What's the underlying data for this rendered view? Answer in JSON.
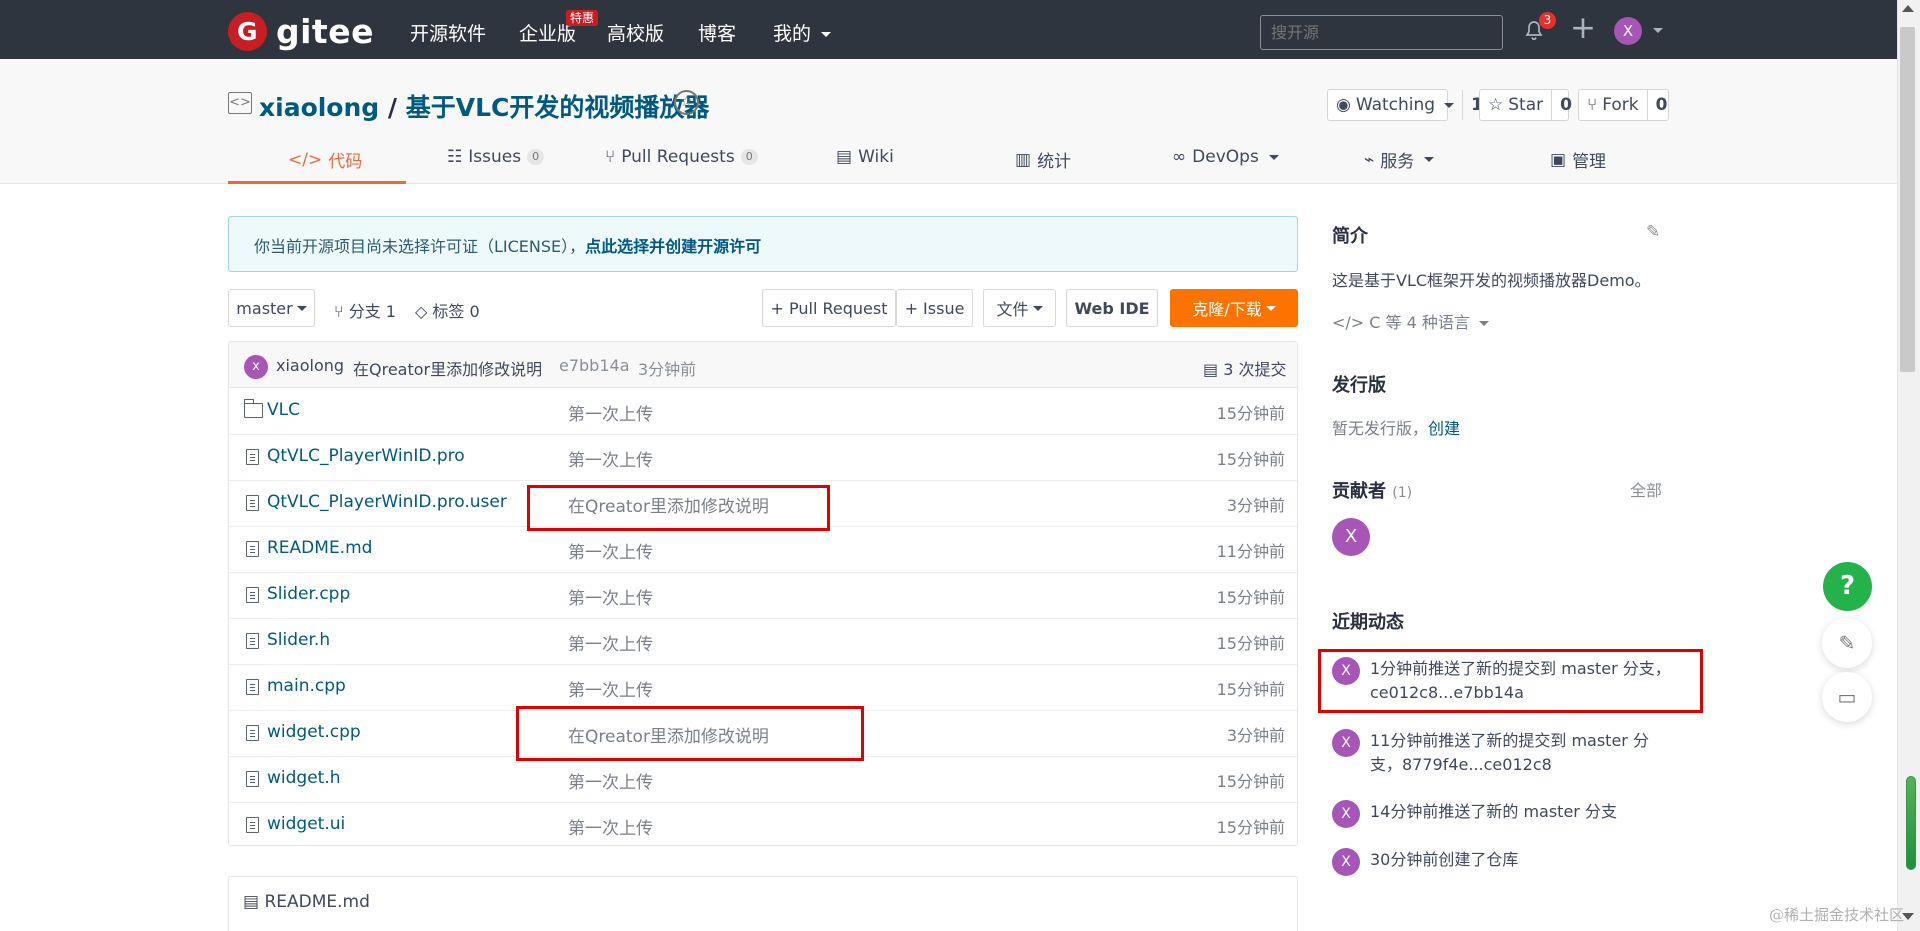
{
  "top_nav": {
    "brand": "gitee",
    "logo_letter": "G",
    "items": [
      "开源软件",
      "企业版",
      "高校版",
      "博客",
      "我的"
    ],
    "hot_badge": "特惠",
    "search_placeholder": "搜开源",
    "notification_count": "3",
    "plus_icon": "+",
    "user_avatar": "X"
  },
  "repo": {
    "owner": "xiaolong",
    "separator": "/",
    "name": "基于VLC开发的视频播放器",
    "repo_icon": "<>",
    "medal_icon": "☆",
    "watch": {
      "label": "Watching",
      "count": "1"
    },
    "star": {
      "label": "Star",
      "count": "0"
    },
    "fork": {
      "label": "Fork",
      "count": "0"
    }
  },
  "tabs": [
    {
      "label": "代码",
      "icon": "</>"
    },
    {
      "label": "Issues",
      "count": "0",
      "icon": "☷"
    },
    {
      "label": "Pull Requests",
      "count": "0",
      "icon": "⑂"
    },
    {
      "label": "Wiki",
      "icon": "▤"
    },
    {
      "label": "统计",
      "icon": "▥"
    },
    {
      "label": "DevOps",
      "icon": "∞"
    },
    {
      "label": "服务",
      "icon": "⌁"
    },
    {
      "label": "管理",
      "icon": "▣"
    }
  ],
  "license": {
    "text": "你当前开源项目尚未选择许可证（LICENSE），",
    "link": "点此选择并创建开源许可"
  },
  "toolbar": {
    "branch": "master",
    "branch_count": "分支 1",
    "tag_count": "标签 0",
    "pull_request": "+ Pull Request",
    "issue": "+ Issue",
    "files": "文件",
    "web_ide": "Web IDE",
    "clone": "克隆/下载"
  },
  "last_commit": {
    "author": "xiaolong",
    "avatar": "x",
    "message": "在Qreator里添加修改说明",
    "hash": "e7bb14a",
    "time": "3分钟前",
    "commits": "3 次提交"
  },
  "files": [
    {
      "name": "VLC",
      "type": "folder",
      "message": "第一次上传",
      "time": "15分钟前"
    },
    {
      "name": "QtVLC_PlayerWinID.pro",
      "type": "file",
      "message": "第一次上传",
      "time": "15分钟前"
    },
    {
      "name": "QtVLC_PlayerWinID.pro.user",
      "type": "file",
      "message": "在Qreator里添加修改说明",
      "time": "3分钟前"
    },
    {
      "name": "README.md",
      "type": "file",
      "message": "第一次上传",
      "time": "11分钟前"
    },
    {
      "name": "Slider.cpp",
      "type": "file",
      "message": "第一次上传",
      "time": "15分钟前"
    },
    {
      "name": "Slider.h",
      "type": "file",
      "message": "第一次上传",
      "time": "15分钟前"
    },
    {
      "name": "main.cpp",
      "type": "file",
      "message": "第一次上传",
      "time": "15分钟前"
    },
    {
      "name": "widget.cpp",
      "type": "file",
      "message": "在Qreator里添加修改说明",
      "time": "3分钟前"
    },
    {
      "name": "widget.h",
      "type": "file",
      "message": "第一次上传",
      "time": "15分钟前"
    },
    {
      "name": "widget.ui",
      "type": "file",
      "message": "第一次上传",
      "time": "15分钟前"
    }
  ],
  "readme_title": "README.md",
  "sidebar": {
    "intro_title": "简介",
    "intro_text": "这是基于VLC框架开发的视频播放器Demo。",
    "languages": "C 等 4 种语言",
    "releases_title": "发行版",
    "releases_text": "暂无发行版，",
    "releases_link": "创建",
    "contributors_title": "贡献者",
    "contributors_count": "(1)",
    "contributors_all": "全部",
    "contributor_avatar": "X",
    "activity_title": "近期动态",
    "activities": [
      {
        "text": "1分钟前推送了新的提交到 master 分支，ce012c8...e7bb14a",
        "avatar": "X"
      },
      {
        "text": "11分钟前推送了新的提交到 master 分支，8779f4e...ce012c8",
        "avatar": "X"
      },
      {
        "text": "14分钟前推送了新的 master 分支",
        "avatar": "X"
      },
      {
        "text": "30分钟前创建了仓库",
        "avatar": "X"
      }
    ]
  },
  "floating": {
    "help": "?",
    "edit_icon": "✎",
    "message_icon": "▭"
  },
  "watermark": "@稀土掘金技术社区",
  "colors": {
    "brand": "#c71d23",
    "accent_orange": "#fe7300",
    "active_tab": "#f1673f",
    "link_blue": "#005980",
    "highlight_red": "#e00000",
    "help_green": "#24b24a"
  }
}
